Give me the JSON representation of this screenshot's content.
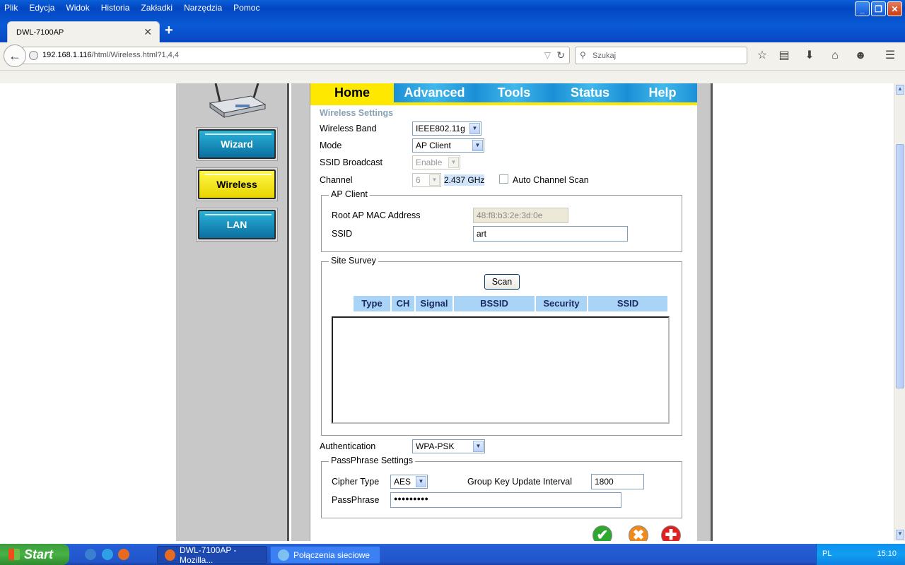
{
  "browser": {
    "menu": [
      "Plik",
      "Edycja",
      "Widok",
      "Historia",
      "Zakładki",
      "Narzędzia",
      "Pomoc"
    ],
    "tab_title": "DWL-7100AP",
    "url_host": "192.168.1.116",
    "url_path": "/html/Wireless.html?1,4,4",
    "search_placeholder": "Szukaj"
  },
  "router": {
    "nav": [
      {
        "label": "Wizard",
        "style": "blue"
      },
      {
        "label": "Wireless",
        "style": "yellow"
      },
      {
        "label": "LAN",
        "style": "blue"
      }
    ],
    "tabs": [
      "Home",
      "Advanced",
      "Tools",
      "Status",
      "Help"
    ],
    "active_tab": "Home",
    "section_title": "Wireless Settings",
    "wireless_band_label": "Wireless Band",
    "wireless_band_value": "IEEE802.11g",
    "mode_label": "Mode",
    "mode_value": "AP Client",
    "ssid_broadcast_label": "SSID Broadcast",
    "ssid_broadcast_value": "Enable",
    "channel_label": "Channel",
    "channel_value": "6",
    "frequency": "2.437 GHz",
    "auto_channel_scan_label": "Auto Channel Scan",
    "ap_client": {
      "legend": "AP Client",
      "root_mac_label": "Root AP MAC Address",
      "root_mac_value": "48:f8:b3:2e:3d:0e",
      "ssid_label": "SSID",
      "ssid_value": "art"
    },
    "site_survey": {
      "legend": "Site Survey",
      "scan_label": "Scan",
      "columns": [
        "Type",
        "CH",
        "Signal",
        "BSSID",
        "Security",
        "SSID"
      ]
    },
    "authentication_label": "Authentication",
    "authentication_value": "WPA-PSK",
    "passphrase_settings": {
      "legend": "PassPhrase Settings",
      "cipher_label": "Cipher Type",
      "cipher_value": "AES",
      "group_key_label": "Group Key Update Interval",
      "group_key_value": "1800",
      "passphrase_label": "PassPhrase",
      "passphrase_value": "●●●●●●●●●"
    },
    "action_buttons": [
      {
        "name": "apply",
        "symbol": "✔",
        "color": "#2fa82f"
      },
      {
        "name": "cancel",
        "symbol": "✖",
        "color": "#f08a1a"
      },
      {
        "name": "help",
        "symbol": "✚",
        "color": "#e02020"
      }
    ]
  },
  "taskbar": {
    "start_label": "Start",
    "tasks": [
      "DWL-7100AP - Mozilla...",
      "Połączenia sieciowe"
    ],
    "language": "PL",
    "clock": "15:10"
  }
}
